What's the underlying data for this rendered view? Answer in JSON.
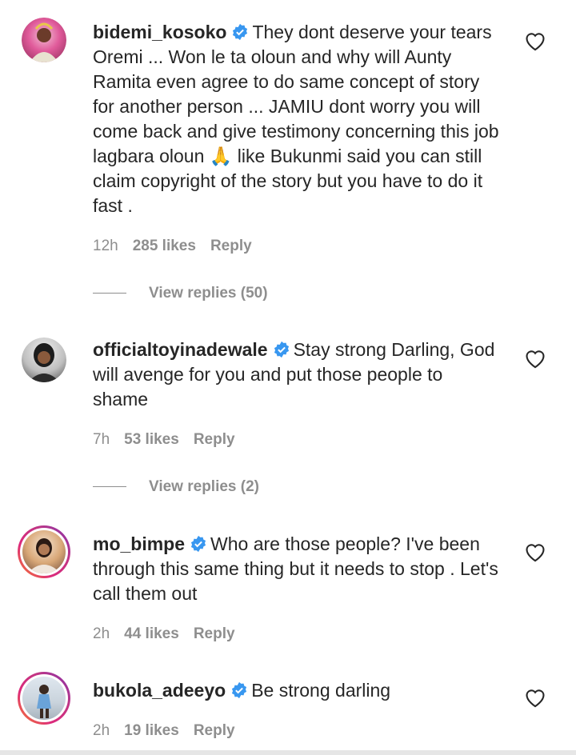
{
  "comments": [
    {
      "username": "bidemi_kosoko",
      "text": "They dont deserve your tears Oremi ... Won le ta oloun and why will Aunty Ramita even agree to do same concept of story for another person ... JAMIU dont worry you will come back and give testimony concerning this job lagbara oloun 🙏 like Bukunmi said you can still claim copyright of the story but you have to do it fast .",
      "time": "12h",
      "likes": "285 likes",
      "reply": "Reply",
      "view_replies": "View replies (50)"
    },
    {
      "username": "officialtoyinadewale",
      "text": "Stay strong Darling, God will avenge for you and put those people to shame",
      "time": "7h",
      "likes": "53 likes",
      "reply": "Reply",
      "view_replies": "View replies (2)"
    },
    {
      "username": "mo_bimpe",
      "text": "Who are those people? I've been through this same thing but it needs to stop . Let's call them out",
      "time": "2h",
      "likes": "44 likes",
      "reply": "Reply"
    },
    {
      "username": "bukola_adeeyo",
      "text": "Be strong darling",
      "time": "2h",
      "likes": "19 likes",
      "reply": "Reply"
    }
  ],
  "icons": {
    "verified": "verified-badge-icon",
    "like": "heart-icon"
  },
  "colors": {
    "verified": "#3897f0",
    "muted": "#8e8e8e",
    "text": "#262626"
  }
}
